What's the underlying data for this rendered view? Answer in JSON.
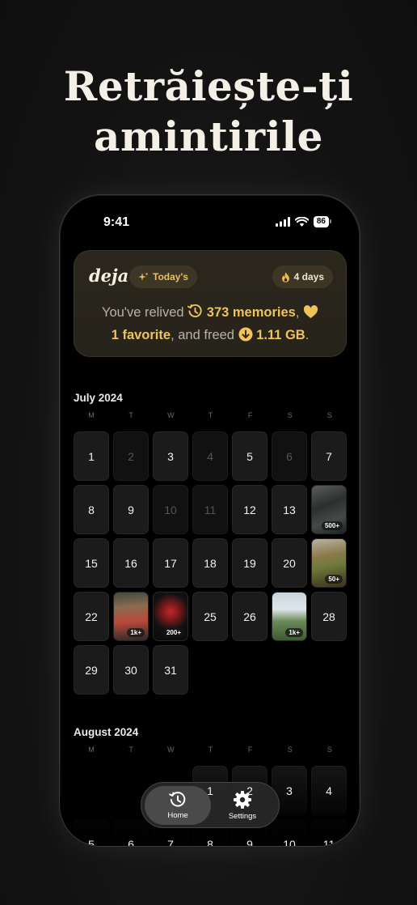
{
  "headline": {
    "line1": "Retrăiește-ți",
    "line2": "amintirile"
  },
  "status_bar": {
    "time": "9:41",
    "battery": "86"
  },
  "summary_card": {
    "logo": "deja",
    "today_pill": "Today's",
    "streak_pill": "4 days",
    "text_prefix": "You've relived",
    "memories": "373 memories",
    "sep": ",",
    "favorites": "1 favorite",
    "text_mid": ", and freed",
    "freed": "1.11 GB",
    "text_end": "."
  },
  "weekday_labels": [
    "M",
    "T",
    "W",
    "T",
    "F",
    "S",
    "S"
  ],
  "july": {
    "title": "July 2024",
    "days": [
      {
        "n": "1",
        "dim": false
      },
      {
        "n": "2",
        "dim": true
      },
      {
        "n": "3",
        "dim": false
      },
      {
        "n": "4",
        "dim": true
      },
      {
        "n": "5",
        "dim": false
      },
      {
        "n": "6",
        "dim": true
      },
      {
        "n": "7",
        "dim": false
      },
      {
        "n": "8",
        "dim": false
      },
      {
        "n": "9",
        "dim": false
      },
      {
        "n": "10",
        "dim": true
      },
      {
        "n": "11",
        "dim": true
      },
      {
        "n": "12",
        "dim": false
      },
      {
        "n": "13",
        "dim": false
      },
      {
        "n": "14",
        "dim": false,
        "photo": "bike",
        "count": "500+"
      },
      {
        "n": "15",
        "dim": false
      },
      {
        "n": "16",
        "dim": false
      },
      {
        "n": "17",
        "dim": false
      },
      {
        "n": "18",
        "dim": false
      },
      {
        "n": "19",
        "dim": false
      },
      {
        "n": "20",
        "dim": false
      },
      {
        "n": "21",
        "dim": false,
        "photo": "room",
        "count": "50+"
      },
      {
        "n": "22",
        "dim": false
      },
      {
        "n": "23",
        "dim": false,
        "photo": "person",
        "count": "1k+"
      },
      {
        "n": "24",
        "dim": false,
        "photo": "red",
        "count": "200+"
      },
      {
        "n": "25",
        "dim": false
      },
      {
        "n": "26",
        "dim": false
      },
      {
        "n": "27",
        "dim": false,
        "photo": "tent",
        "count": "1k+"
      },
      {
        "n": "28",
        "dim": false
      },
      {
        "n": "29",
        "dim": false
      },
      {
        "n": "30",
        "dim": false
      },
      {
        "n": "31",
        "dim": false
      }
    ]
  },
  "august": {
    "title": "August 2024",
    "days": [
      {
        "n": "1"
      },
      {
        "n": "2"
      },
      {
        "n": "3"
      },
      {
        "n": "4"
      },
      {
        "n": "5"
      },
      {
        "n": "6"
      },
      {
        "n": "7"
      },
      {
        "n": "8"
      },
      {
        "n": "9"
      },
      {
        "n": "10"
      },
      {
        "n": "11"
      }
    ]
  },
  "tabbar": {
    "home": "Home",
    "settings": "Settings"
  },
  "colors": {
    "accent": "#f0c25c",
    "background": "#000000"
  }
}
